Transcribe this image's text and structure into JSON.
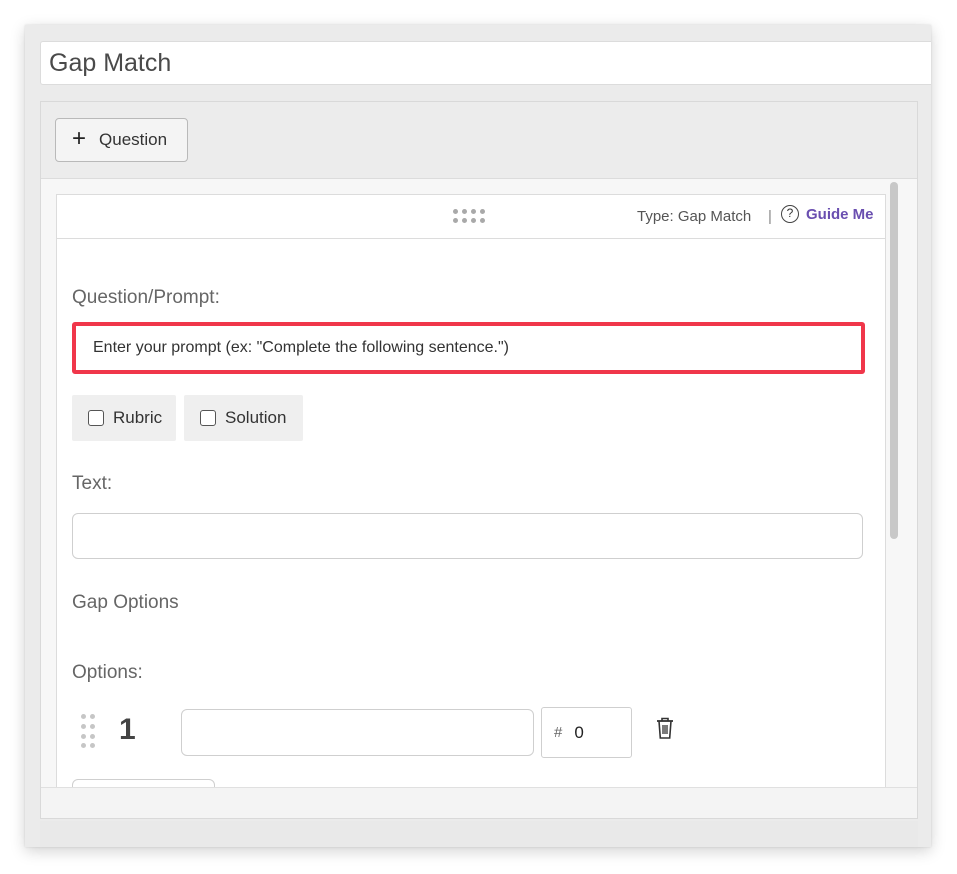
{
  "title_field": {
    "value": "Gap Match"
  },
  "toolbar": {
    "add_question_icon": "+",
    "add_question_label": "Question"
  },
  "card": {
    "type_label": "Type: Gap Match",
    "separator": "|",
    "help_icon": "?",
    "guide_label": "Guide Me",
    "prompt_label": "Question/Prompt:",
    "prompt_placeholder": "Enter your prompt (ex: \"Complete the following sentence.\")",
    "rubric_label": "Rubric",
    "solution_label": "Solution",
    "text_label": "Text:",
    "gap_options_heading": "Gap Options",
    "options_label": "Options:",
    "options": [
      {
        "number": "1",
        "score_symbol": "#",
        "score": "0"
      }
    ]
  },
  "colors": {
    "highlight": "#f0364a",
    "guide_link": "#6a4fb0"
  }
}
